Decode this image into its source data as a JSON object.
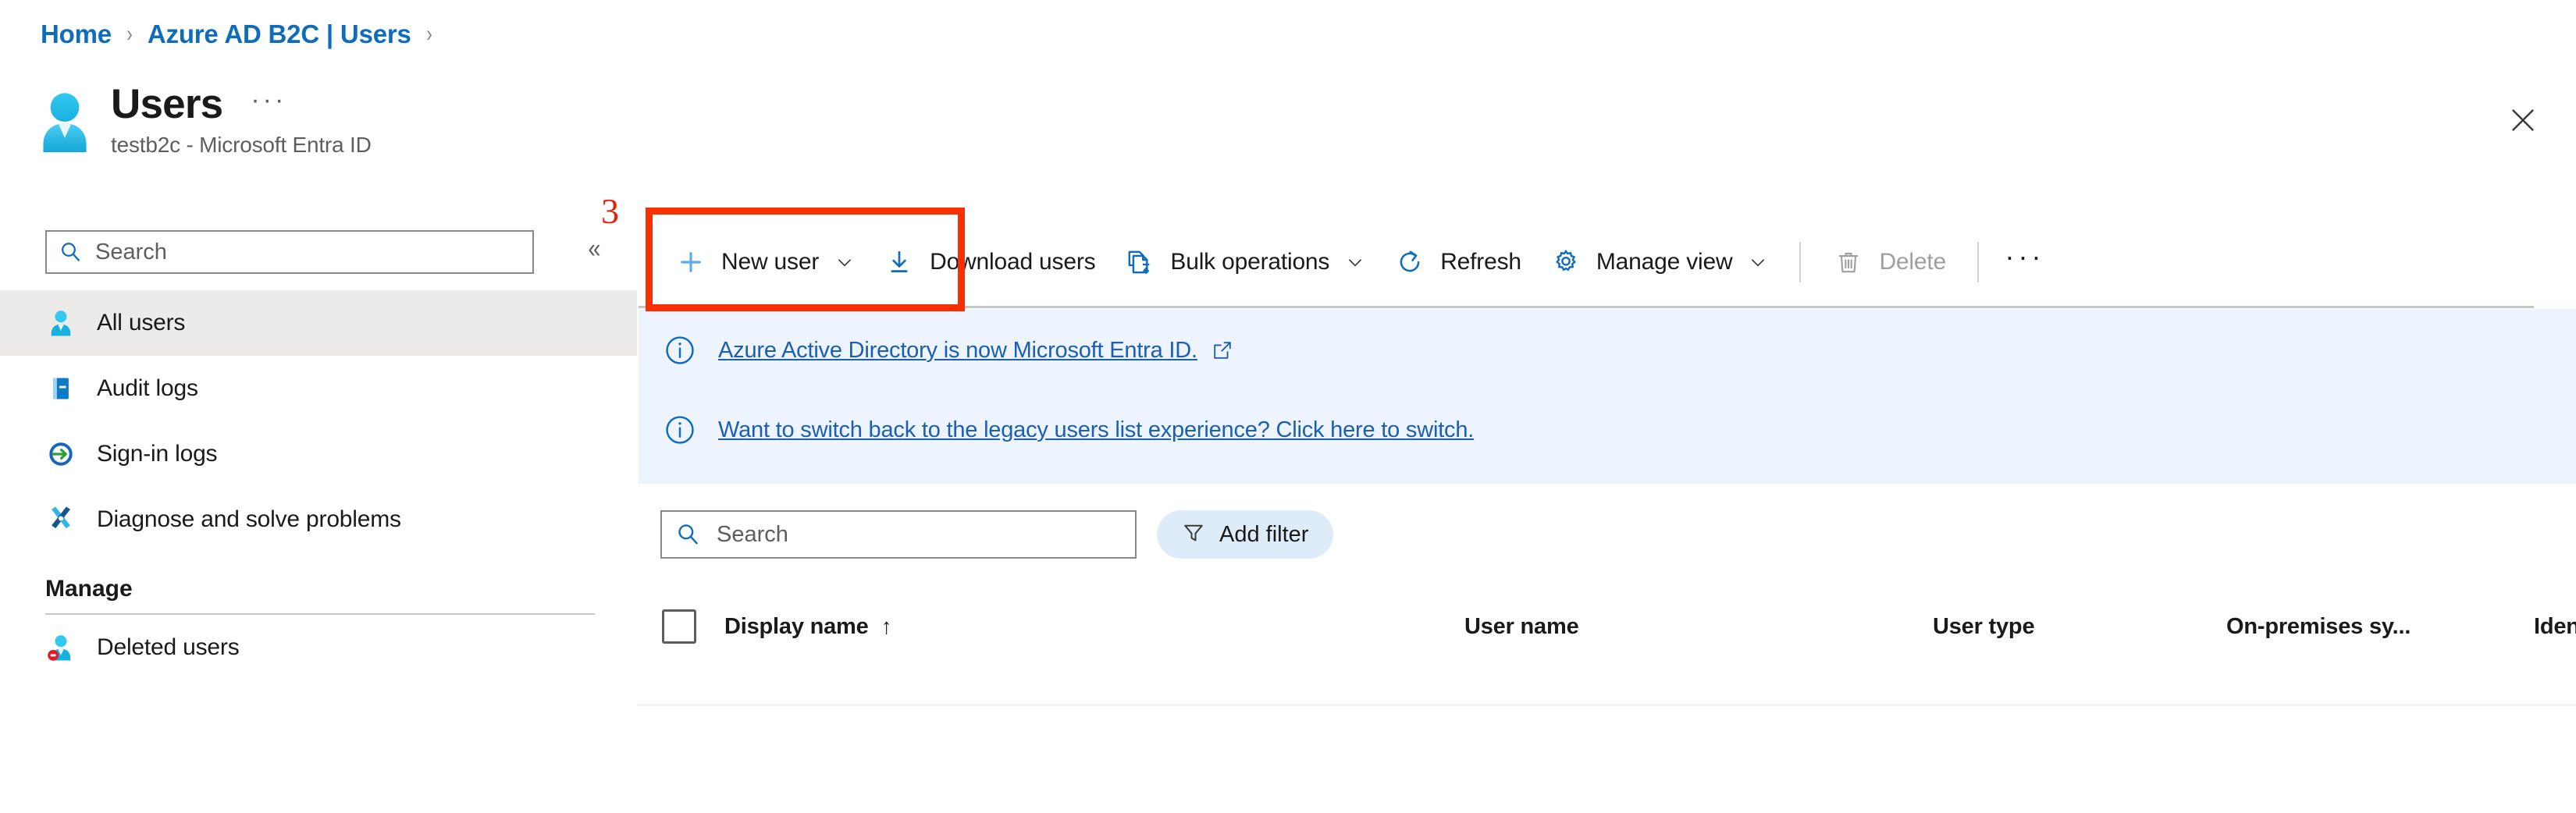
{
  "breadcrumb": {
    "items": [
      {
        "label": "Home"
      },
      {
        "label": "Azure AD B2C | Users"
      }
    ],
    "separator": "›"
  },
  "header": {
    "title": "Users",
    "subtitle": "testb2c - Microsoft Entra ID",
    "ellipsis": "···",
    "icon": "user-icon",
    "close_icon": "close-icon"
  },
  "sidebar": {
    "search": {
      "placeholder": "Search",
      "value": "",
      "icon": "search-icon"
    },
    "collapse_icon": "«",
    "items": [
      {
        "label": "All users",
        "icon": "all-users-icon",
        "selected": true
      },
      {
        "label": "Audit logs",
        "icon": "audit-logs-icon",
        "selected": false
      },
      {
        "label": "Sign-in logs",
        "icon": "sign-in-logs-icon",
        "selected": false
      },
      {
        "label": "Diagnose and solve problems",
        "icon": "diagnose-icon",
        "selected": false
      }
    ],
    "group_title": "Manage",
    "manage_items": [
      {
        "label": "Deleted users",
        "icon": "deleted-users-icon",
        "selected": false
      }
    ]
  },
  "command_bar": {
    "new_user": {
      "label": "New user",
      "icon": "plus-icon",
      "has_chevron": true
    },
    "download_users": {
      "label": "Download users",
      "icon": "download-icon",
      "has_chevron": false
    },
    "bulk_operations": {
      "label": "Bulk operations",
      "icon": "bulk-operations-icon",
      "has_chevron": true
    },
    "refresh": {
      "label": "Refresh",
      "icon": "refresh-icon",
      "has_chevron": false
    },
    "manage_view": {
      "label": "Manage view",
      "icon": "gear-icon",
      "has_chevron": true
    },
    "delete": {
      "label": "Delete",
      "icon": "trash-icon",
      "disabled": true
    },
    "overflow": {
      "label": "···",
      "icon": "ellipsis-icon"
    }
  },
  "banners": [
    {
      "icon": "info-icon",
      "text": "Azure Active Directory is now Microsoft Entra ID.",
      "external_link_icon": "external-link-icon",
      "has_external_icon": true
    },
    {
      "icon": "info-icon",
      "text": "Want to switch back to the legacy users list experience? Click here to switch.",
      "has_external_icon": false
    }
  ],
  "list_toolbar": {
    "search": {
      "placeholder": "Search",
      "value": "",
      "icon": "search-icon"
    },
    "add_filter": {
      "label": "Add filter",
      "icon": "filter-icon"
    }
  },
  "table": {
    "select_all": {
      "checked": false
    },
    "columns": [
      {
        "key": "display_name",
        "label": "Display name",
        "sorted": true,
        "sort_arrow": "↑"
      },
      {
        "key": "user_name",
        "label": "User name",
        "sorted": false
      },
      {
        "key": "user_type",
        "label": "User type",
        "sorted": false
      },
      {
        "key": "on_premises",
        "label": "On-premises sy...",
        "sorted": false
      },
      {
        "key": "identities",
        "label": "Identities",
        "sorted": false
      }
    ],
    "rows": []
  },
  "annotation": {
    "number": "3",
    "target": "new-user-button",
    "color": "#f82f00"
  },
  "colors": {
    "accent_blue": "#0f6cbd",
    "link_blue": "#1a5fb4",
    "banner_bg": "#eef4fd",
    "selected_nav_bg": "#edebe9",
    "filter_chip_bg": "#deecf9",
    "annotation_red": "#f82f00"
  }
}
